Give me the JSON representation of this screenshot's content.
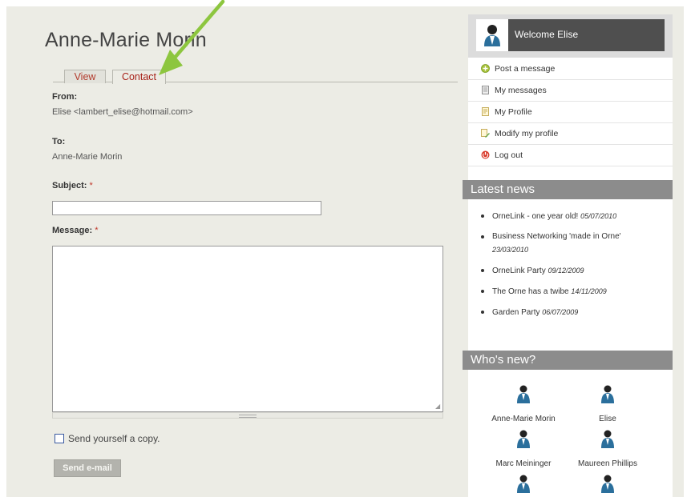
{
  "profile": {
    "name": "Anne-Marie Morin",
    "tabs": [
      {
        "label": "View"
      },
      {
        "label": "Contact"
      }
    ]
  },
  "form": {
    "from_label": "From:",
    "from_value": "Elise <lambert_elise@hotmail.com>",
    "to_label": "To:",
    "to_value": "Anne-Marie Morin",
    "subject_label": "Subject:",
    "subject_value": "",
    "message_label": "Message:",
    "message_value": "",
    "required_mark": "*",
    "copy_label": "Send yourself a copy.",
    "copy_checked": false,
    "send_label": "Send e-mail"
  },
  "sidebar": {
    "welcome": "Welcome Elise",
    "menu": [
      {
        "label": "Post a message",
        "icon": "plus-circle-icon"
      },
      {
        "label": "My messages",
        "icon": "document-icon"
      },
      {
        "label": "My Profile",
        "icon": "profile-card-icon"
      },
      {
        "label": "Modify my profile",
        "icon": "edit-profile-icon"
      },
      {
        "label": "Log out",
        "icon": "logout-icon"
      }
    ],
    "news_title": "Latest news",
    "news": [
      {
        "title": "OrneLink - one year old!",
        "date": "05/07/2010"
      },
      {
        "title": "Business Networking 'made in Orne'",
        "date": "23/03/2010"
      },
      {
        "title": "OrneLink Party",
        "date": "09/12/2009"
      },
      {
        "title": "The Orne has a twibe",
        "date": "14/11/2009"
      },
      {
        "title": "Garden Party",
        "date": "06/07/2009"
      }
    ],
    "who_title": "Who's new?",
    "members": [
      {
        "name": "Anne-Marie Morin"
      },
      {
        "name": "Elise"
      },
      {
        "name": "Marc Meininger"
      },
      {
        "name": "Maureen Phillips"
      }
    ]
  },
  "colors": {
    "tab_text": "#a8231a",
    "arrow": "#8dc63f",
    "section_header": "#8c8c8c",
    "welcome_bg": "#4f4f4f"
  }
}
